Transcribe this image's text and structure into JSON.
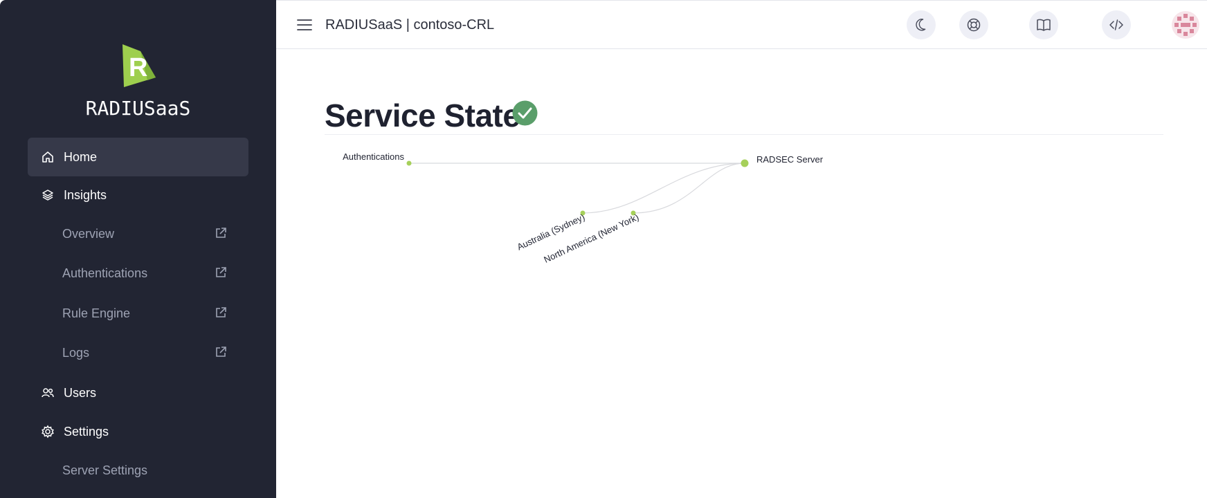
{
  "sidebar": {
    "brand": "RADIUSaaS",
    "items": [
      {
        "label": "Home",
        "icon": "home-icon",
        "active": true
      },
      {
        "label": "Insights",
        "icon": "layers-icon"
      },
      {
        "label": "Overview",
        "icon": "external-link-icon"
      },
      {
        "label": "Authentications",
        "icon": "external-link-icon"
      },
      {
        "label": "Rule Engine",
        "icon": "external-link-icon"
      },
      {
        "label": "Logs",
        "icon": "external-link-icon"
      },
      {
        "label": "Users",
        "icon": "users-icon"
      },
      {
        "label": "Settings",
        "icon": "gear-icon"
      },
      {
        "label": "Server Settings"
      }
    ]
  },
  "header": {
    "title": "RADIUSaaS | contoso-CRL",
    "buttons": [
      "moon-icon",
      "lifebuoy-icon",
      "book-icon",
      "code-icon"
    ]
  },
  "main": {
    "title": "Service State",
    "status": "ok"
  },
  "graph": {
    "nodes": [
      {
        "label": "Authentications"
      },
      {
        "label": "RADSEC Server"
      },
      {
        "label": "Australia (Sydney)"
      },
      {
        "label": "North America (New York)"
      }
    ]
  },
  "colors": {
    "sidebar_bg": "#222533",
    "active_item_bg": "#363949",
    "accent_green": "#a6d05a",
    "status_green": "#5a9e6a"
  }
}
